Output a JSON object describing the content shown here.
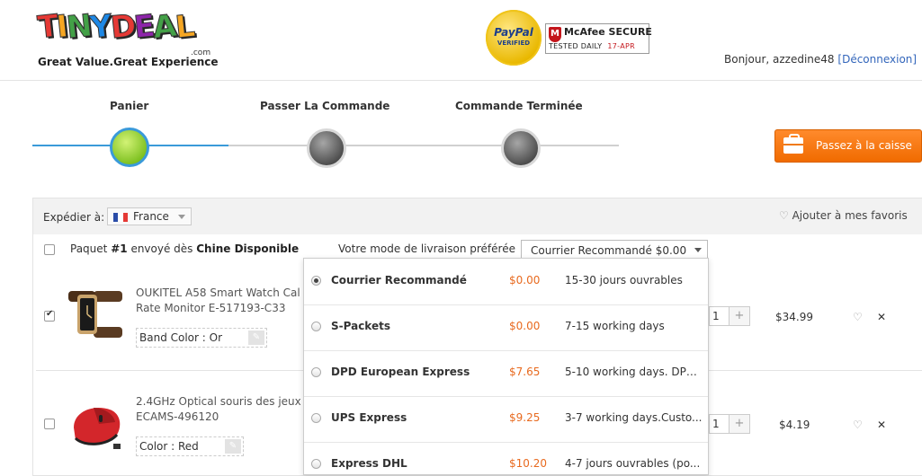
{
  "brand": {
    "logo_letters": [
      "T",
      "I",
      "N",
      "Y",
      "D",
      "E",
      "A",
      "L"
    ],
    "logo_colors": [
      "#e53935",
      "#f5a623",
      "#43a047",
      "#1e88e5",
      "#e53935",
      "#8e24aa",
      "#43a047",
      "#f5a623"
    ],
    "logo_suffix": ".com",
    "tagline": "Great Value.Great Experience"
  },
  "badges": {
    "paypal_name": "PayPal",
    "paypal_sub": "VERIFIED",
    "mcafee_name": "McAfee SECURE",
    "mcafee_tested": "TESTED DAILY",
    "mcafee_date": "17-APR"
  },
  "user": {
    "greeting": "Bonjour, azzedine48",
    "logout": "[Déconnexion]"
  },
  "steps": [
    {
      "label": "Panier",
      "state": "active"
    },
    {
      "label": "Passer La Commande",
      "state": "pending"
    },
    {
      "label": "Commande Terminée",
      "state": "pending"
    }
  ],
  "checkout_button": "Passez à la caisse",
  "cart": {
    "ship_to_label": "Expédier à:",
    "country": "France",
    "add_favorites": "Ajouter à mes favoris",
    "package": {
      "prefix": "Paquet",
      "number": "#1",
      "middle": "envoyé dès",
      "origin": "Chine Disponible"
    },
    "shipping_mode_label": "Votre mode de livraison préférée",
    "shipping_mode_selected": "Courrier Recommandé $0.00",
    "items": [
      {
        "name_line1": "OUKITEL A58 Smart Watch Cal",
        "name_line2": "Rate Monitor E-517193-C33",
        "attribute": "Band Color : Or",
        "qty": "1",
        "price": "$34.99",
        "checked": true
      },
      {
        "name_line1": "2.4GHz Optical souris des jeux",
        "name_line2": "ECAMS-496120",
        "attribute": "Color : Red",
        "qty": "1",
        "price": "$4.19",
        "checked": false
      }
    ]
  },
  "shipping_options": [
    {
      "name": "Courrier Recommandé",
      "price": "$0.00",
      "delay": "15-30 jours ouvrables",
      "selected": true
    },
    {
      "name": "S-Packets",
      "price": "$0.00",
      "delay": "7-15 working days",
      "selected": false
    },
    {
      "name": "DPD European Express",
      "price": "$7.65",
      "delay": "5-10 working days. DPD...",
      "selected": false
    },
    {
      "name": "UPS Express",
      "price": "$9.25",
      "delay": "3-7 working days.Custo...",
      "selected": false
    },
    {
      "name": "Express DHL",
      "price": "$10.20",
      "delay": "4-7 jours ouvrables (po...",
      "selected": false
    }
  ],
  "colors": {
    "accent_blue": "#3a9ad9",
    "active_step_green": "#7bbf1e",
    "checkout_orange": "#f07a10",
    "price_orange": "#e86a1f"
  }
}
